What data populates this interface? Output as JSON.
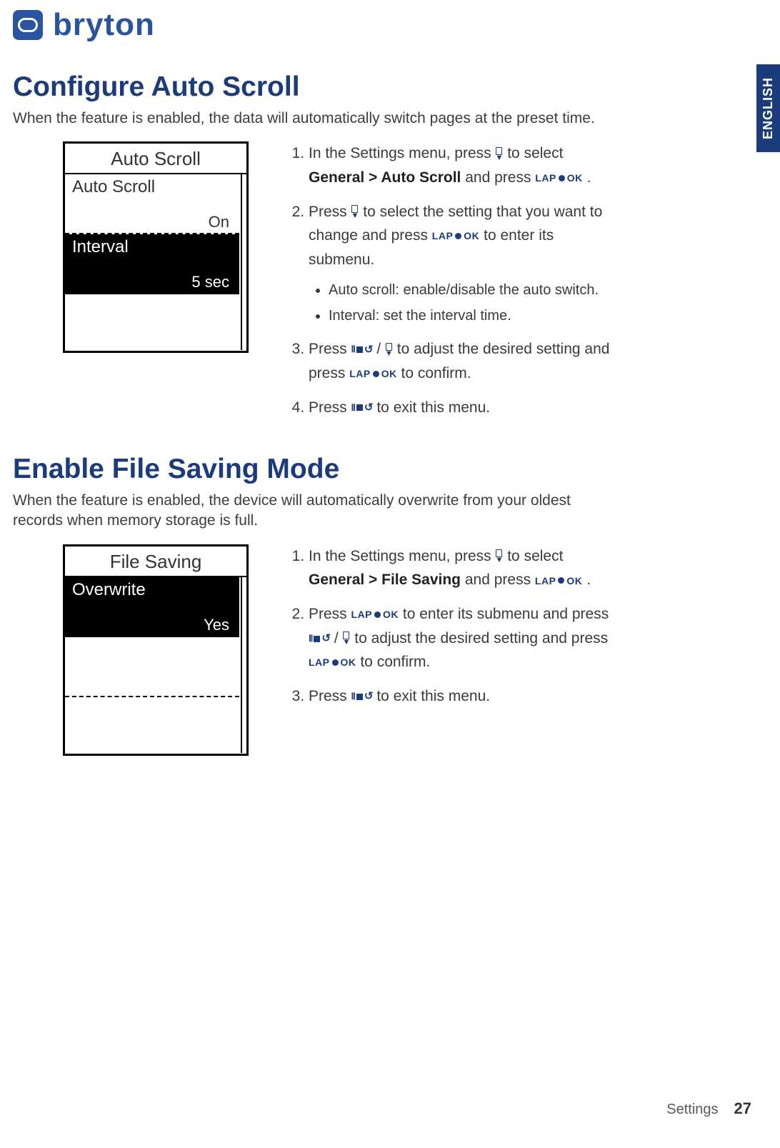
{
  "brand": "bryton",
  "language_tab": "ENGLISH",
  "section1": {
    "heading": "Configure Auto Scroll",
    "intro": "When the feature is enabled, the data will automatically switch pages at the preset time.",
    "device": {
      "title": "Auto Scroll",
      "item1_label": "Auto Scroll",
      "item1_value": "On",
      "item2_label": "Interval",
      "item2_value": "5 sec"
    },
    "steps": {
      "s1_a": "In the Settings menu, press ",
      "s1_b": " to select ",
      "s1_bold": "General > Auto Scroll",
      "s1_c": " and press ",
      "s1_d": " .",
      "s2_a": "Press ",
      "s2_b": " to select the setting that you want to change and press ",
      "s2_c": " to enter its submenu.",
      "sub1": "Auto scroll: enable/disable the auto switch.",
      "sub2": "Interval: set the interval time.",
      "s3_a": "Press ",
      "s3_slash": " / ",
      "s3_b": " to adjust the desired setting and press ",
      "s3_c": " to confirm.",
      "s4_a": "Press ",
      "s4_b": " to exit this menu."
    }
  },
  "section2": {
    "heading": "Enable File Saving Mode",
    "intro": "When the feature is enabled, the device will automatically overwrite from your oldest records when memory storage is full.",
    "device": {
      "title": "File Saving",
      "item1_label": "Overwrite",
      "item1_value": "Yes"
    },
    "steps": {
      "s1_a": "In the Settings menu, press ",
      "s1_b": " to select ",
      "s1_bold": "General > File Saving",
      "s1_c": "  and press ",
      "s1_d": " .",
      "s2_a": "Press ",
      "s2_b": " to enter its submenu and press ",
      "s2_slash": " / ",
      "s2_c": " to adjust the desired setting and press ",
      "s2_d": " to confirm.",
      "s3_a": "Press ",
      "s3_b": " to exit this menu."
    }
  },
  "buttons": {
    "lap": "LAP",
    "ok": "OK"
  },
  "footer": {
    "section": "Settings",
    "page": "27"
  }
}
